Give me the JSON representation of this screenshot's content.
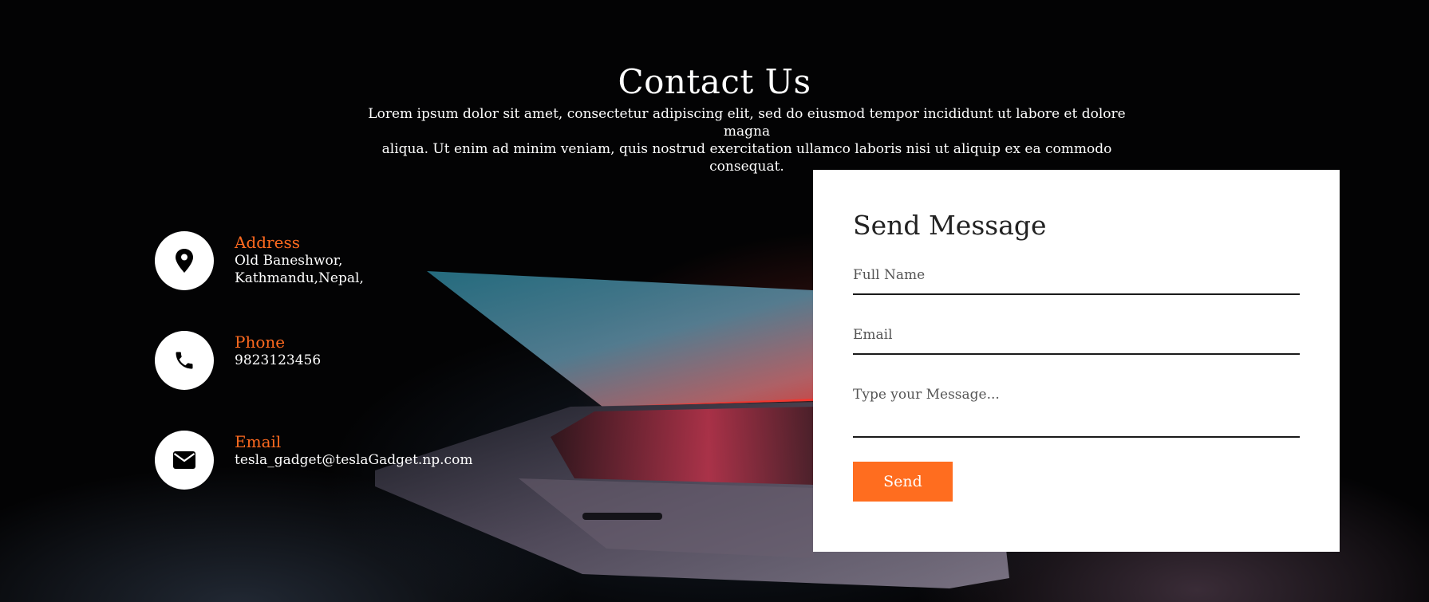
{
  "header": {
    "title": "Contact Us",
    "intro_line1": "Lorem ipsum dolor sit amet, consectetur adipiscing elit, sed do eiusmod tempor incididunt ut labore et dolore magna",
    "intro_line2": "aliqua. Ut enim ad minim veniam, quis nostrud exercitation ullamco laboris nisi ut aliquip ex ea commodo consequat."
  },
  "contact_info": {
    "address": {
      "icon": "map-marker-icon",
      "label": "Address",
      "line1": "Old Baneshwor,",
      "line2": "Kathmandu,Nepal,"
    },
    "phone": {
      "icon": "phone-icon",
      "label": "Phone",
      "value": "9823123456"
    },
    "email": {
      "icon": "envelope-icon",
      "label": "Email",
      "value": "tesla_gadget@teslaGadget.np.com"
    }
  },
  "form": {
    "title": "Send Message",
    "full_name_placeholder": "Full Name",
    "email_placeholder": "Email",
    "message_placeholder": "Type your Message...",
    "send_label": "Send"
  },
  "colors": {
    "accent": "#ff6d1f",
    "background": "#000000",
    "card": "#ffffff"
  }
}
